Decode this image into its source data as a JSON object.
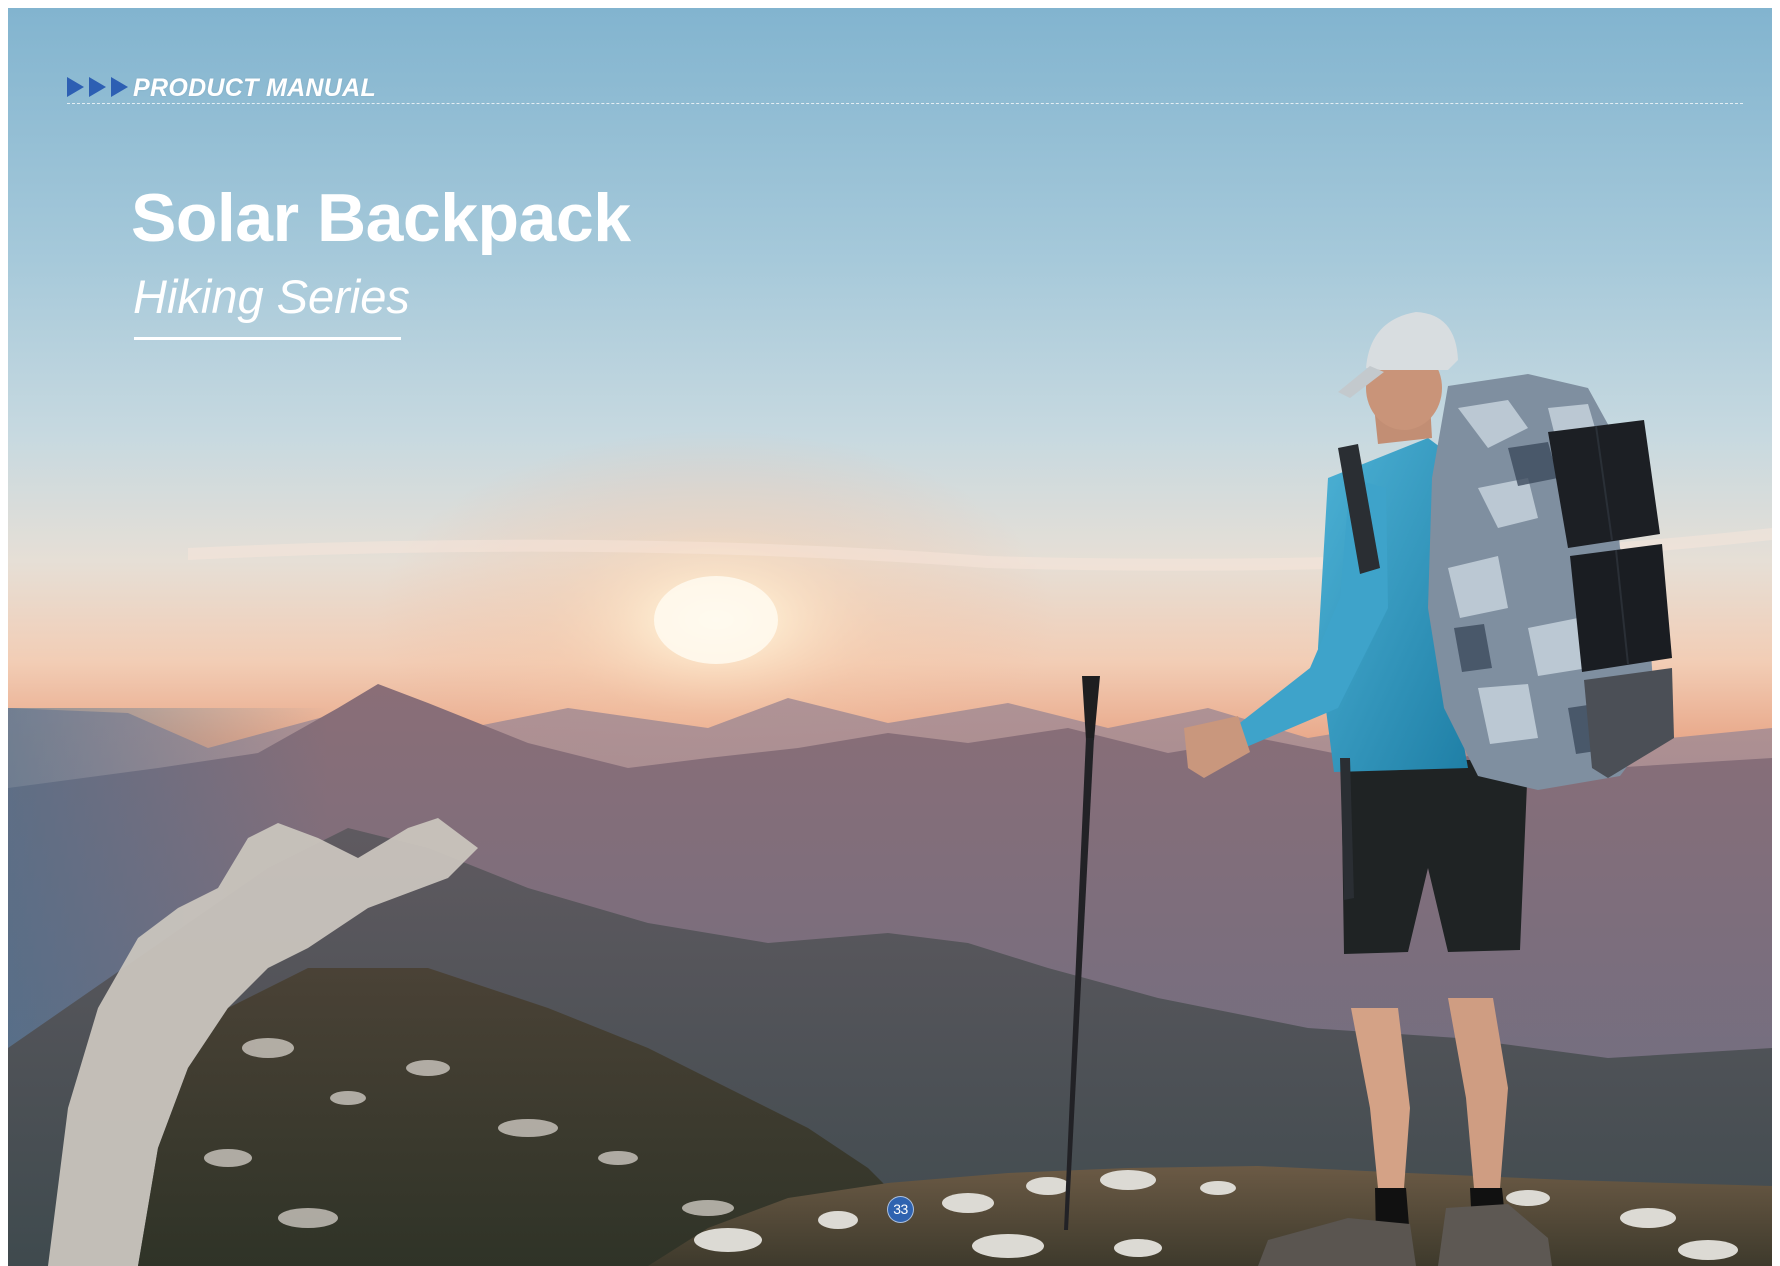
{
  "header": {
    "label": "PRODUCT MANUAL",
    "marker_icon": "triple-arrow-icon",
    "marker_color": "#2d5fb3"
  },
  "cover": {
    "title": "Solar Backpack",
    "subtitle": "Hiking Series"
  },
  "footer": {
    "page_number": "33",
    "badge_color": "#2f63b0"
  }
}
